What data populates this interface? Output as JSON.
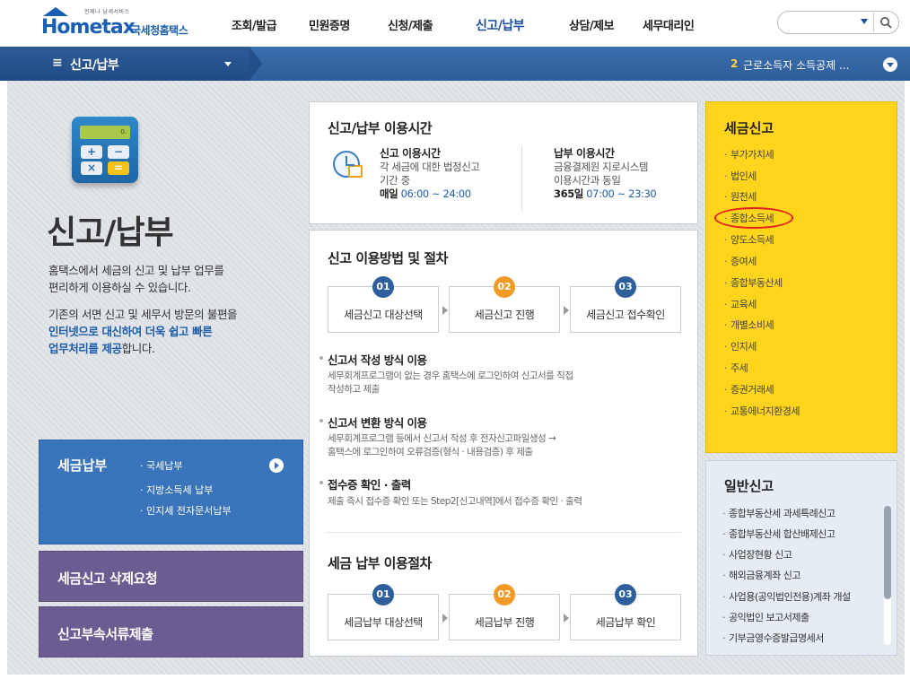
{
  "header": {
    "logo_tag": "언제나 납세서비스",
    "logo_brand": "Hometax",
    "logo_kr": "국세청홈택스",
    "nav": [
      "조회/발급",
      "민원증명",
      "신청/제출",
      "신고/납부",
      "상담/제보",
      "세무대리인"
    ],
    "active_nav": "신고/납부",
    "search_placeholder": ""
  },
  "menubar": {
    "menu_icon": "≡",
    "title": "신고/납부",
    "notice_num": "2",
    "notice_text": "근로소득자 소득공제 ..."
  },
  "intro": {
    "calc_screen": "0.",
    "title": "신고/납부",
    "line1": "홈택스에서 세금의 신고 및 납부 업무를",
    "line2": "편리하게 이용하실 수 있습니다.",
    "line3": "기존의 서면 신고 및 세무서 방문의 불편을",
    "line4": "인터넷으로 대신하여 더욱 쉽고 빠른",
    "line5a": "업무처리를 제공",
    "line5b": "합니다."
  },
  "left_cards": {
    "pay_title": "세금납부",
    "pay_items": [
      "· 국세납부",
      "· 지방소득세 납부",
      "· 인지세 전자문서납부"
    ],
    "delete_title": "세금신고 삭제요청",
    "attach_title": "신고부속서류제출"
  },
  "time_panel": {
    "title": "신고/납부 이용시간",
    "report_head": "신고 이용시간",
    "report_desc1": "각 세금에 대한 법정신고",
    "report_desc2": "기간 중",
    "report_daily": "매일",
    "report_hours": "06:00 ~ 24:00",
    "pay_head": "납부 이용시간",
    "pay_desc1": "금융결제원 지로시스템",
    "pay_desc2": "이용시간과 동일",
    "pay_days": "365일",
    "pay_hours": "07:00 ~ 23:30"
  },
  "process_panel": {
    "title": "신고 이용방법 및 절차",
    "steps": [
      {
        "num": "01",
        "label": "세금신고 대상선택"
      },
      {
        "num": "02",
        "label": "세금신고 진행"
      },
      {
        "num": "03",
        "label": "세금신고 접수확인"
      }
    ],
    "s1_head": "신고서 작성 방식 이용",
    "s1_desc1": "세무회계프로그램이 없는 경우 홈택스에 로그인하여 신고서를 직접",
    "s1_desc2": "작성하고 제출",
    "s2_head": "신고서 변환 방식 이용",
    "s2_desc1": "세무회계프로그램 등에서 신고서 작성 후 전자신고파일생성 →",
    "s2_desc2": "홈택스에 로그인하여 오류검증(형식 · 내용검증) 후 제출",
    "s3_head": "접수증 확인 · 출력",
    "s3_desc1": "제출 즉시 접수증 확인 또는 Step2[신고내역]에서 접수증 확인 · 출력",
    "pay_title": "세금 납부 이용절차",
    "pay_steps": [
      {
        "num": "01",
        "label": "세금납부 대상선택"
      },
      {
        "num": "02",
        "label": "세금납부 진행"
      },
      {
        "num": "03",
        "label": "세금납부 확인"
      }
    ]
  },
  "tax_report": {
    "title": "세금신고",
    "items": [
      "부가가치세",
      "법인세",
      "원천세",
      "종합소득세",
      "양도소득세",
      "증여세",
      "종합부동산세",
      "교육세",
      "개별소비세",
      "인지세",
      "주세",
      "증권거래세",
      "교통에너지환경세"
    ]
  },
  "general_report": {
    "title": "일반신고",
    "items": [
      "종합부동산세 과세특례신고",
      "종합부동산세 합산배제신고",
      "사업장현황 신고",
      "해외금융계좌 신고",
      "사업용(공익법인전용)계좌 개설",
      "공익법인 보고서제출",
      "기부금영수증발급명세서"
    ]
  },
  "colors": {
    "brand": "#1b5fb5",
    "menubar": "#2d5d9a",
    "tax_panel": "#ffd41c",
    "pay_card": "#3a74bb",
    "purple_card": "#6b5d91",
    "step_orange": "#f19b26",
    "highlight_circle": "#e3201b"
  }
}
